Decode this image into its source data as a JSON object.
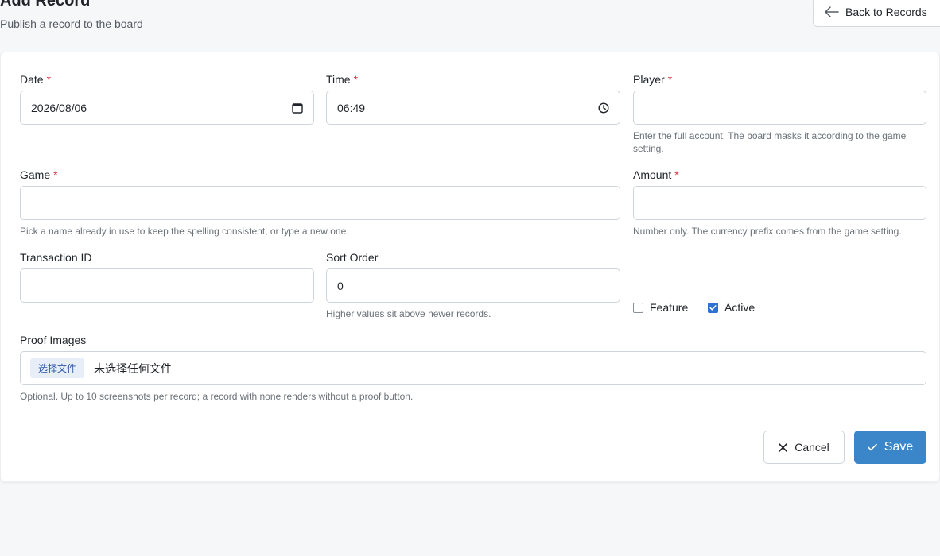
{
  "header": {
    "title": "Add Record",
    "subtitle": "Publish a record to the board",
    "back_label": "Back to Records"
  },
  "form": {
    "date": {
      "label": "Date",
      "required": "*",
      "value": "2026/08/06"
    },
    "time": {
      "label": "Time",
      "required": "*",
      "value": "06:49"
    },
    "player": {
      "label": "Player",
      "required": "*",
      "value": "",
      "help": "Enter the full account. The board masks it according to the game setting."
    },
    "game": {
      "label": "Game",
      "required": "*",
      "value": "",
      "help": "Pick a name already in use to keep the spelling consistent, or type a new one."
    },
    "amount": {
      "label": "Amount",
      "required": "*",
      "value": "",
      "help": "Number only. The currency prefix comes from the game setting."
    },
    "transaction_id": {
      "label": "Transaction ID",
      "value": ""
    },
    "sort_order": {
      "label": "Sort Order",
      "value": "0",
      "help": "Higher values sit above newer records."
    },
    "feature": {
      "label": "Feature",
      "checked": false
    },
    "active": {
      "label": "Active",
      "checked": true
    },
    "proof_images": {
      "label": "Proof Images",
      "button_label": "选择文件",
      "status": "未选择任何文件",
      "help": "Optional. Up to 10 screenshots per record; a record with none renders without a proof button."
    }
  },
  "actions": {
    "cancel_label": "Cancel",
    "save_label": "Save"
  },
  "colors": {
    "accent": "#3a86c8",
    "checkbox": "#2f6fd6",
    "required": "#dc3545"
  }
}
